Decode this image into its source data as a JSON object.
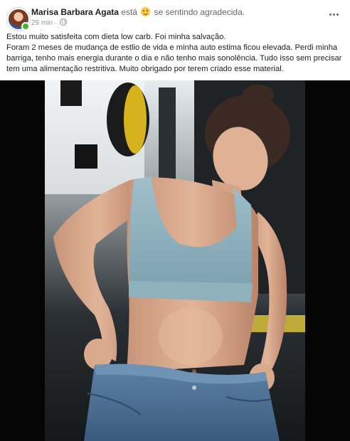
{
  "post": {
    "author": "Marisa Barbara Agata",
    "feeling_prefix": "está",
    "feeling_icon": "smiling-face-emoji",
    "feeling_text": "se sentindo agradecida.",
    "time": "29 min",
    "audience_icon": "globe-icon",
    "more_icon": "more-options-icon",
    "text_lines": [
      "Estou muito satisfeita com dieta low carb. Foi minha salvação.",
      "Foram 2 meses de mudança de estlio de vida e minha auto estima ficou elevada. Perdi minha barriga, tenho mais energia durante o dia e não tenho mais sonolência. Tudo isso sem precisar tem uma alimentação restritiva. Muito obrigado por terem criado esse material."
    ],
    "photo": {
      "subject": "woman-in-sports-bra-showing-loose-jeans",
      "colors": {
        "top": "#8fb0bd",
        "jeans": "#4a6f94",
        "skin": "#d9a98b",
        "background": "#1e2225"
      }
    }
  },
  "theme": {
    "link_color": "#1c1e21",
    "muted": "#606770",
    "online": "#42b72a"
  }
}
